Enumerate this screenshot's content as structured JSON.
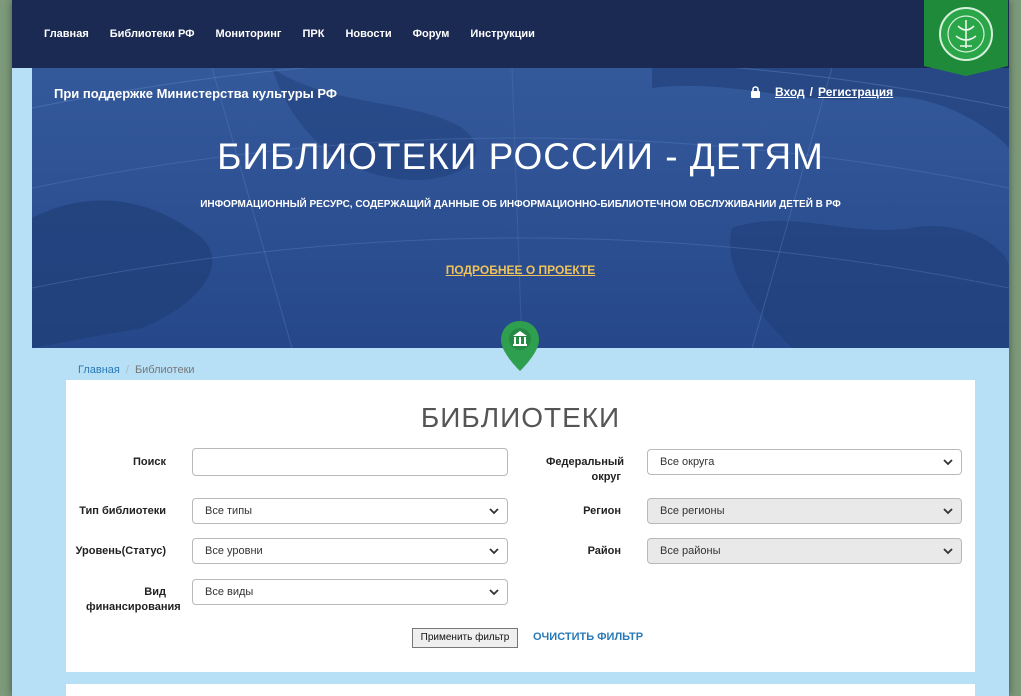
{
  "nav": {
    "items": [
      "Главная",
      "Библиотеки РФ",
      "Мониторинг",
      "ПРК",
      "Новости",
      "Форум",
      "Инструкции"
    ]
  },
  "hero": {
    "support": "При поддержке Министерства культуры РФ",
    "login": "Вход",
    "sep": "/",
    "register": "Регистрация",
    "title": "БИБЛИОТЕКИ РОССИИ - ДЕТЯМ",
    "subtitle": "ИНФОРМАЦИОННЫЙ РЕСУРС,  СОДЕРЖАЩИЙ ДАННЫЕ ОБ ИНФОРМАЦИОННО-БИБЛИОТЕЧНОМ ОБСЛУЖИВАНИИ ДЕТЕЙ В РФ",
    "more": "ПОДРОБНЕЕ О ПРОЕКТЕ"
  },
  "breadcrumb": {
    "home": "Главная",
    "sep": "/",
    "current": "Библиотеки"
  },
  "filter": {
    "title": "БИБЛИОТЕКИ",
    "search_label": "Поиск",
    "search_value": "",
    "district_label": "Федеральный округ",
    "district_value": "Все округа",
    "type_label": "Тип библиотеки",
    "type_value": "Все типы",
    "region_label": "Регион",
    "region_value": "Все регионы",
    "level_label": "Уровень(Статус)",
    "level_value": "Все уровни",
    "area_label": "Район",
    "area_value": "Все районы",
    "funding_label": "Вид финансирования",
    "funding_value": "Все виды",
    "apply_label": "Применить фильтр",
    "clear_label": "ОЧИСТИТЬ ФИЛЬТР"
  },
  "colors": {
    "nav_bg": "#1b2a52",
    "hero_bg": "#2d5394",
    "page_bg": "#b7dff5",
    "accent_link": "#2a7ab8",
    "more_link": "#f0c25a",
    "pin_green": "#2e9e4f"
  }
}
